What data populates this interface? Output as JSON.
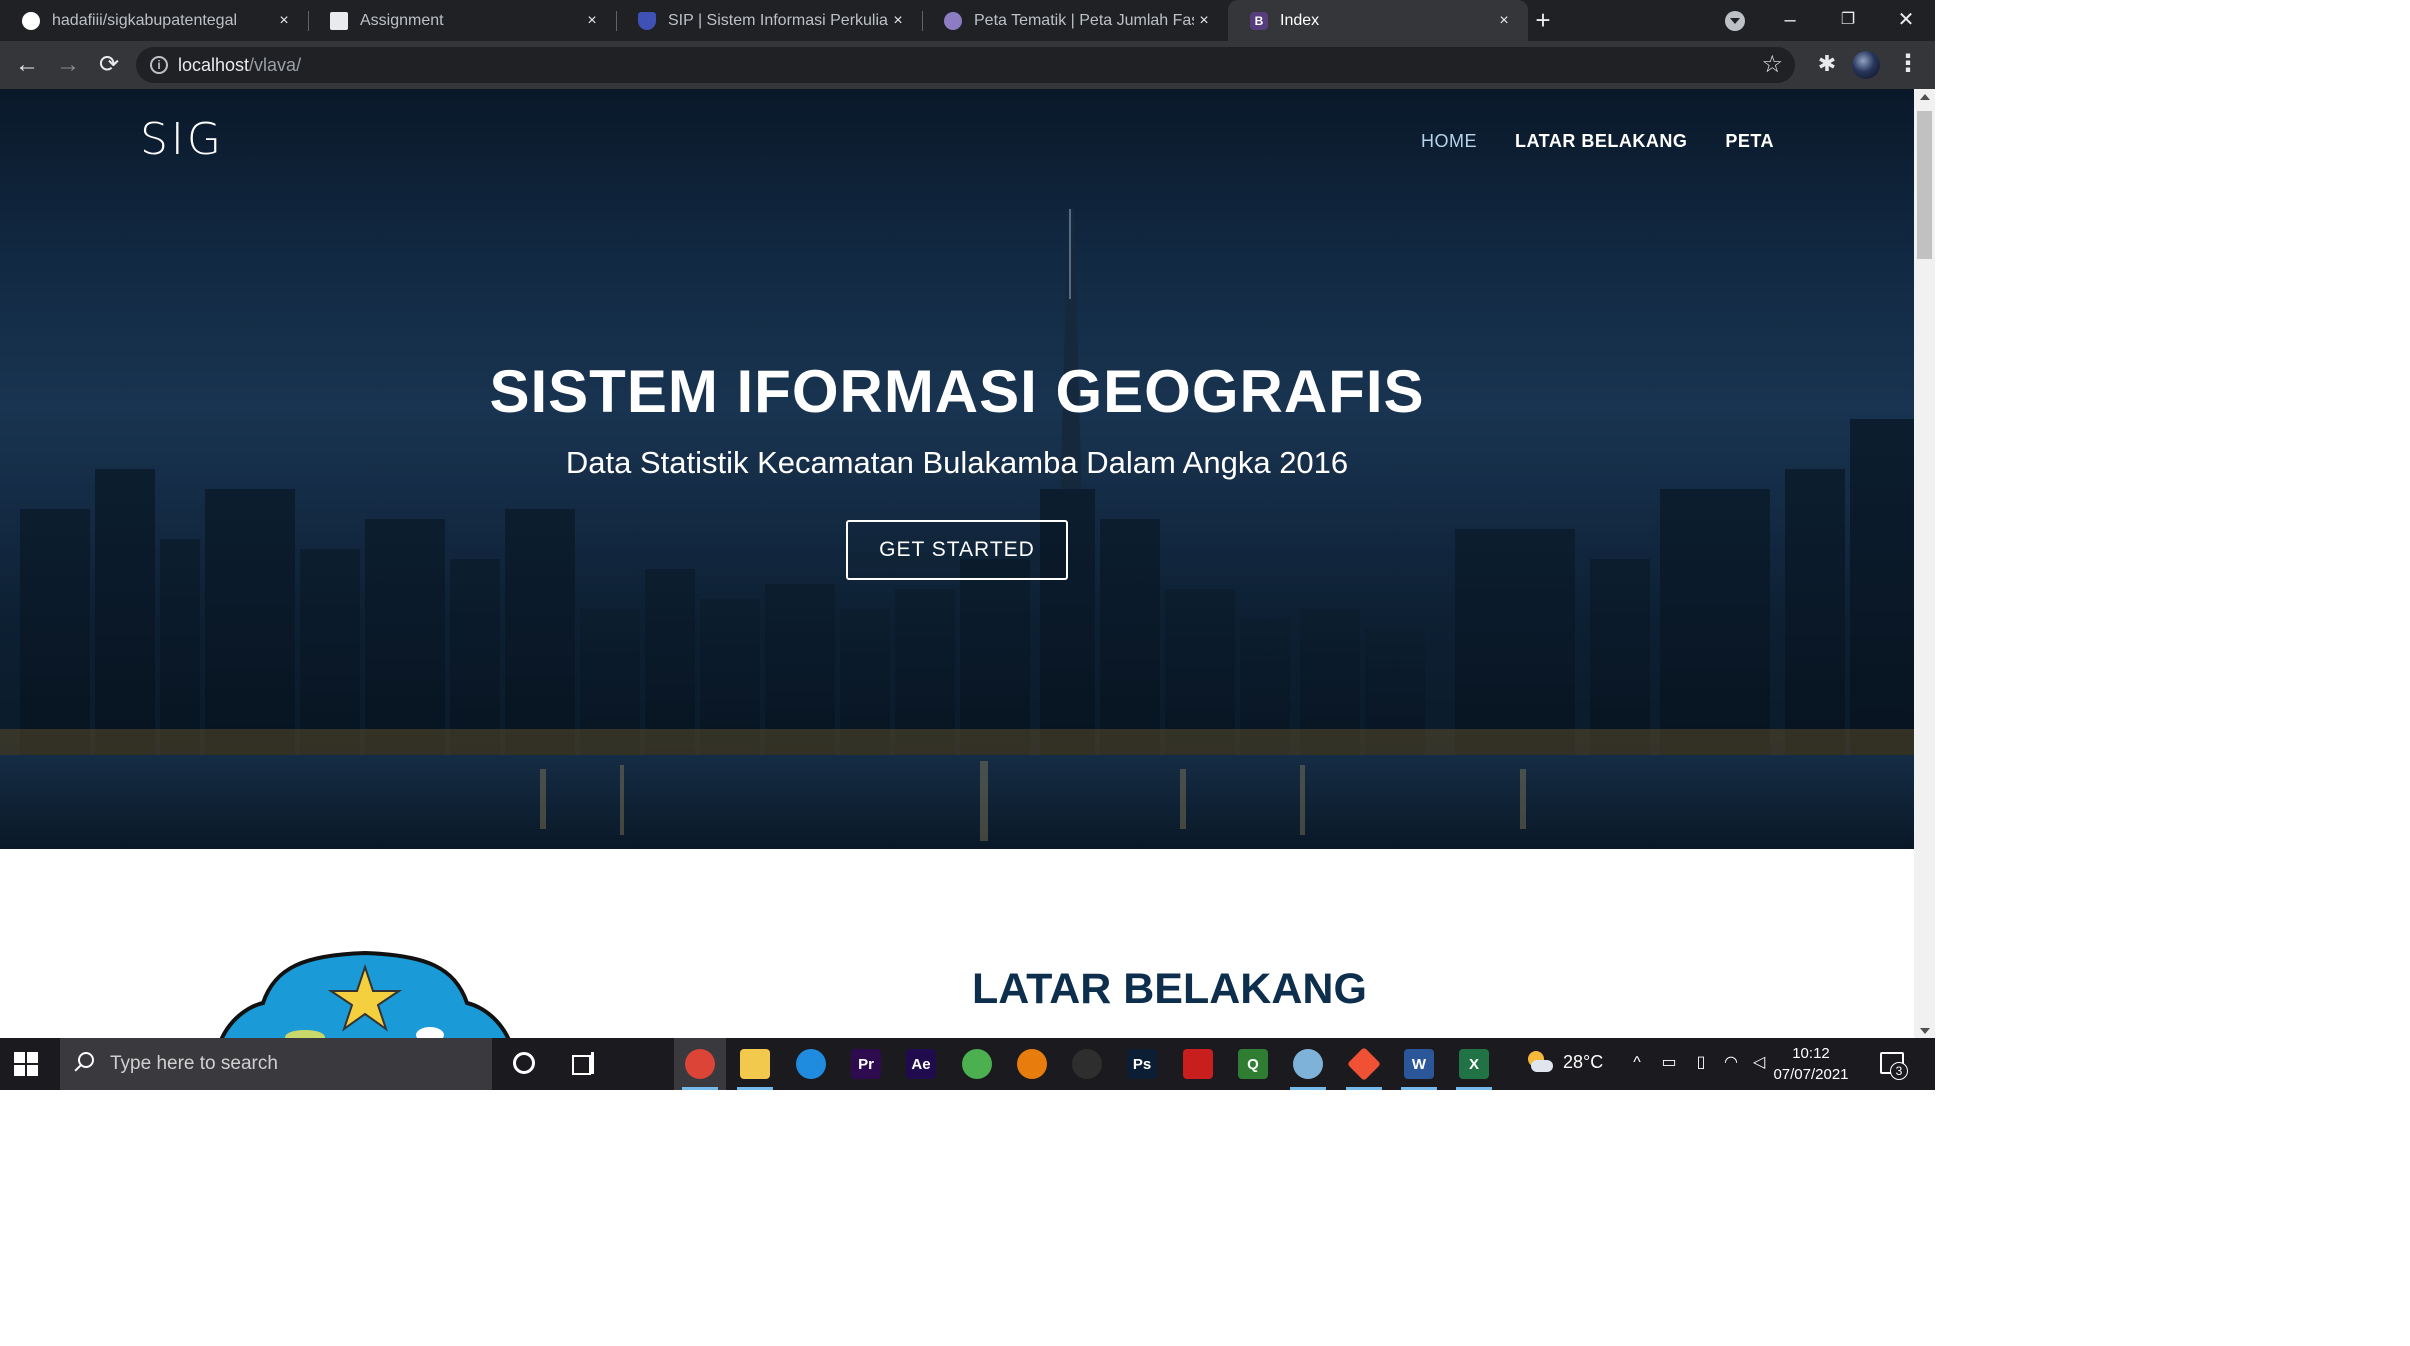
{
  "browser": {
    "tabs": [
      {
        "title": "hadafiii/sigkabupatentegal",
        "icon": "github-icon",
        "active": false
      },
      {
        "title": "Assignment",
        "icon": "assignment-icon",
        "active": false
      },
      {
        "title": "SIP | Sistem Informasi Perkuliahan",
        "icon": "shield-icon",
        "active": false
      },
      {
        "title": "Peta Tematik | Peta Jumlah Fasilitas",
        "icon": "globe-icon",
        "active": false
      },
      {
        "title": "Index",
        "icon": "bootstrap-icon",
        "active": true
      }
    ],
    "close_glyph": "×",
    "new_tab_glyph": "+",
    "window_controls": {
      "minimize": "–",
      "restore": "❐",
      "close": "✕"
    },
    "nav": {
      "back": "←",
      "forward": "→",
      "reload": "⟳"
    },
    "url_host": "localhost",
    "url_path": "/vlava/",
    "star_glyph": "☆",
    "extensions_glyph": "✱",
    "menu_glyph": "⋮"
  },
  "page": {
    "brand": "SIG",
    "nav_links": [
      {
        "label": "HOME",
        "current": true
      },
      {
        "label": "LATAR BELAKANG",
        "current": false
      },
      {
        "label": "PETA",
        "current": false
      }
    ],
    "hero_title": "SISTEM IFORMASI GEOGRAFIS",
    "hero_subtitle": "Data Statistik Kecamatan Bulakamba Dalam Angka 2016",
    "cta_label": "GET STARTED",
    "section_title": "LATAR BELAKANG",
    "colors": {
      "section_title": "#0d2e4d",
      "logo_blue": "#1a9ad6",
      "logo_star": "#f4d03f"
    }
  },
  "taskbar": {
    "search_placeholder": "Type here to search",
    "apps": [
      {
        "name": "chrome-icon",
        "label": "",
        "color": "#db4437",
        "running": true,
        "active": true
      },
      {
        "name": "file-explorer-icon",
        "label": "",
        "color": "#f2c94c",
        "running": true,
        "active": false
      },
      {
        "name": "edge-icon",
        "label": "",
        "color": "#1f8ce0",
        "running": false,
        "active": false
      },
      {
        "name": "premiere-icon",
        "label": "Pr",
        "color": "#2d0b4e",
        "running": false,
        "active": false
      },
      {
        "name": "after-effects-icon",
        "label": "Ae",
        "color": "#1f0b4e",
        "running": false,
        "active": false
      },
      {
        "name": "globe-app-icon",
        "label": "",
        "color": "#4caf50",
        "running": false,
        "active": false
      },
      {
        "name": "blender-icon",
        "label": "",
        "color": "#e87d0d",
        "running": false,
        "active": false
      },
      {
        "name": "inkscape-icon",
        "label": "",
        "color": "#2e2e2e",
        "running": false,
        "active": false
      },
      {
        "name": "photoshop-icon",
        "label": "Ps",
        "color": "#0b1e33",
        "running": false,
        "active": false
      },
      {
        "name": "flash-icon",
        "label": "",
        "color": "#c81e1e",
        "running": false,
        "active": false
      },
      {
        "name": "qgis-icon",
        "label": "Q",
        "color": "#2e7d32",
        "running": false,
        "active": false
      },
      {
        "name": "gis-app-icon",
        "label": "",
        "color": "#7fb2d9",
        "running": true,
        "active": false
      },
      {
        "name": "git-icon",
        "label": "",
        "color": "#f05033",
        "running": true,
        "active": false
      },
      {
        "name": "word-icon",
        "label": "W",
        "color": "#2b579a",
        "running": true,
        "active": false
      },
      {
        "name": "excel-icon",
        "label": "X",
        "color": "#217346",
        "running": true,
        "active": false
      }
    ],
    "weather_temp": "28°C",
    "time": "10:12",
    "date": "07/07/2021",
    "notification_count": "3",
    "tray": {
      "chevron": "^",
      "battery": "▭",
      "network": "◠",
      "volume": "◁"
    }
  }
}
